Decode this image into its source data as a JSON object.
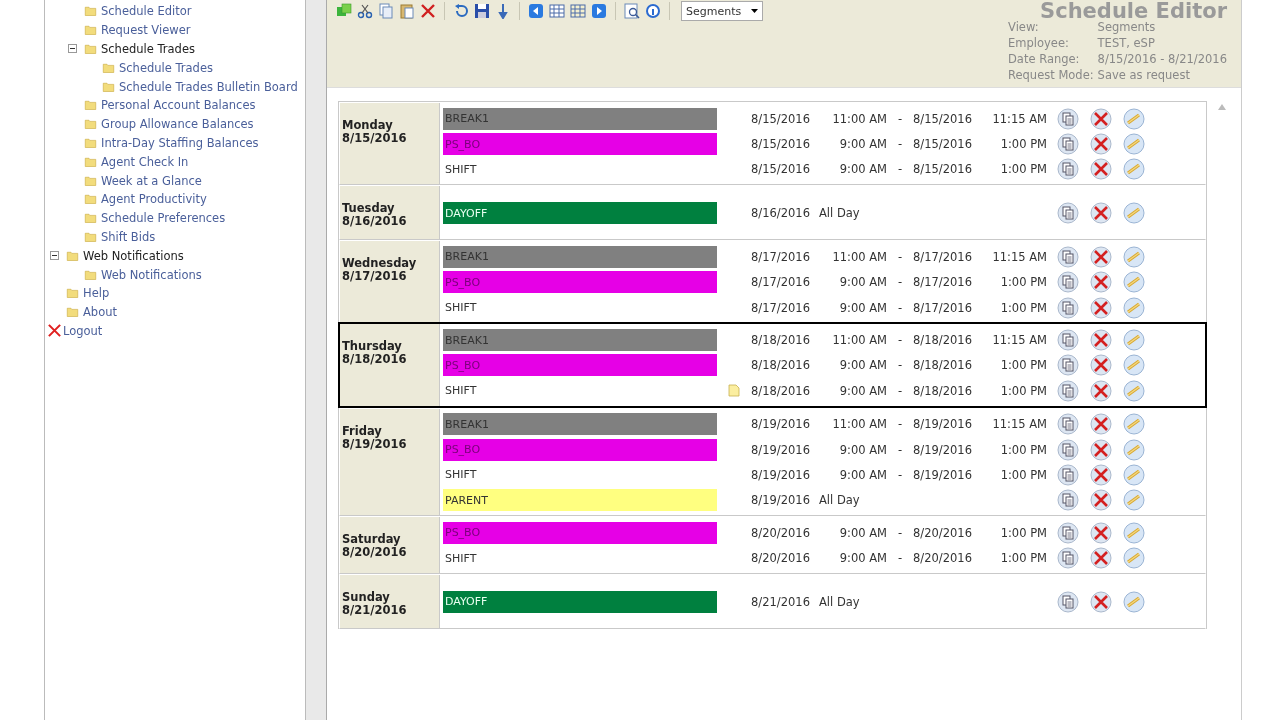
{
  "sidebar": {
    "continued_items": [
      {
        "label": "Schedule Editor"
      },
      {
        "label": "Request Viewer"
      },
      {
        "label": "Schedule Trades",
        "expanded": true,
        "children": [
          {
            "label": "Schedule Trades"
          },
          {
            "label": "Schedule Trades Bulletin Board"
          }
        ]
      },
      {
        "label": "Personal Account Balances"
      },
      {
        "label": "Group Allowance Balances"
      },
      {
        "label": "Intra-Day Staffing Balances"
      },
      {
        "label": "Agent Check In"
      },
      {
        "label": "Week at a Glance"
      },
      {
        "label": "Agent Productivity"
      },
      {
        "label": "Schedule Preferences"
      },
      {
        "label": "Shift Bids"
      }
    ],
    "items": [
      {
        "label": "Web Notifications",
        "expanded": true,
        "children": [
          {
            "label": "Web Notifications"
          }
        ]
      },
      {
        "label": "Help"
      },
      {
        "label": "About"
      },
      {
        "label": "Logout",
        "kind": "logout"
      }
    ]
  },
  "toolbar": {
    "view_select": "Segments",
    "title": "Schedule Editor"
  },
  "info": [
    {
      "label": "View:",
      "value": "Segments"
    },
    {
      "label": "Employee:",
      "value": "TEST, eSP"
    },
    {
      "label": "Date Range:",
      "value": "8/15/2016 - 8/21/2016"
    },
    {
      "label": "Request Mode:",
      "value": "Save as request"
    }
  ],
  "days": [
    {
      "day": "Monday",
      "date": "8/15/2016",
      "selected": false,
      "entries": [
        {
          "name": "BREAK1",
          "color": "#808080",
          "kind": "timed",
          "start_date": "8/15/2016",
          "start_time": "11:00 AM",
          "dash": "-",
          "end_date": "8/15/2016",
          "end_time": "11:15 AM"
        },
        {
          "name": "PS_BO",
          "color": "#e600e6",
          "kind": "timed",
          "start_date": "8/15/2016",
          "start_time": "9:00 AM",
          "dash": "-",
          "end_date": "8/15/2016",
          "end_time": "1:00 PM"
        },
        {
          "name": "SHIFT",
          "kind": "timed",
          "start_date": "8/15/2016",
          "start_time": "9:00 AM",
          "dash": "-",
          "end_date": "8/15/2016",
          "end_time": "1:00 PM"
        }
      ]
    },
    {
      "day": "Tuesday",
      "date": "8/16/2016",
      "selected": false,
      "entries": [
        {
          "name": "DAYOFF",
          "color": "#00803f",
          "kind": "all_day",
          "start_date": "8/16/2016",
          "all_day": "All Day"
        }
      ]
    },
    {
      "day": "Wednesday",
      "date": "8/17/2016",
      "selected": false,
      "entries": [
        {
          "name": "BREAK1",
          "color": "#808080",
          "kind": "timed",
          "start_date": "8/17/2016",
          "start_time": "11:00 AM",
          "dash": "-",
          "end_date": "8/17/2016",
          "end_time": "11:15 AM"
        },
        {
          "name": "PS_BO",
          "color": "#e600e6",
          "kind": "timed",
          "start_date": "8/17/2016",
          "start_time": "9:00 AM",
          "dash": "-",
          "end_date": "8/17/2016",
          "end_time": "1:00 PM"
        },
        {
          "name": "SHIFT",
          "kind": "timed",
          "start_date": "8/17/2016",
          "start_time": "9:00 AM",
          "dash": "-",
          "end_date": "8/17/2016",
          "end_time": "1:00 PM"
        }
      ]
    },
    {
      "day": "Thursday",
      "date": "8/18/2016",
      "selected": true,
      "entries": [
        {
          "name": "BREAK1",
          "color": "#808080",
          "kind": "timed",
          "start_date": "8/18/2016",
          "start_time": "11:00 AM",
          "dash": "-",
          "end_date": "8/18/2016",
          "end_time": "11:15 AM"
        },
        {
          "name": "PS_BO",
          "color": "#e600e6",
          "kind": "timed",
          "start_date": "8/18/2016",
          "start_time": "9:00 AM",
          "dash": "-",
          "end_date": "8/18/2016",
          "end_time": "1:00 PM"
        },
        {
          "name": "SHIFT",
          "kind": "timed",
          "has_note": true,
          "start_date": "8/18/2016",
          "start_time": "9:00 AM",
          "dash": "-",
          "end_date": "8/18/2016",
          "end_time": "1:00 PM"
        }
      ]
    },
    {
      "day": "Friday",
      "date": "8/19/2016",
      "selected": false,
      "entries": [
        {
          "name": "BREAK1",
          "color": "#808080",
          "kind": "timed",
          "start_date": "8/19/2016",
          "start_time": "11:00 AM",
          "dash": "-",
          "end_date": "8/19/2016",
          "end_time": "11:15 AM"
        },
        {
          "name": "PS_BO",
          "color": "#e600e6",
          "kind": "timed",
          "start_date": "8/19/2016",
          "start_time": "9:00 AM",
          "dash": "-",
          "end_date": "8/19/2016",
          "end_time": "1:00 PM"
        },
        {
          "name": "SHIFT",
          "kind": "timed",
          "start_date": "8/19/2016",
          "start_time": "9:00 AM",
          "dash": "-",
          "end_date": "8/19/2016",
          "end_time": "1:00 PM"
        },
        {
          "name": "PARENT",
          "color": "#ffff80",
          "kind": "all_day",
          "start_date": "8/19/2016",
          "all_day": "All Day"
        }
      ]
    },
    {
      "day": "Saturday",
      "date": "8/20/2016",
      "selected": false,
      "entries": [
        {
          "name": "PS_BO",
          "color": "#e600e6",
          "kind": "timed",
          "start_date": "8/20/2016",
          "start_time": "9:00 AM",
          "dash": "-",
          "end_date": "8/20/2016",
          "end_time": "1:00 PM"
        },
        {
          "name": "SHIFT",
          "kind": "timed",
          "start_date": "8/20/2016",
          "start_time": "9:00 AM",
          "dash": "-",
          "end_date": "8/20/2016",
          "end_time": "1:00 PM"
        }
      ]
    },
    {
      "day": "Sunday",
      "date": "8/21/2016",
      "selected": false,
      "entries": [
        {
          "name": "DAYOFF",
          "color": "#00803f",
          "kind": "all_day",
          "start_date": "8/21/2016",
          "all_day": "All Day"
        }
      ]
    }
  ]
}
